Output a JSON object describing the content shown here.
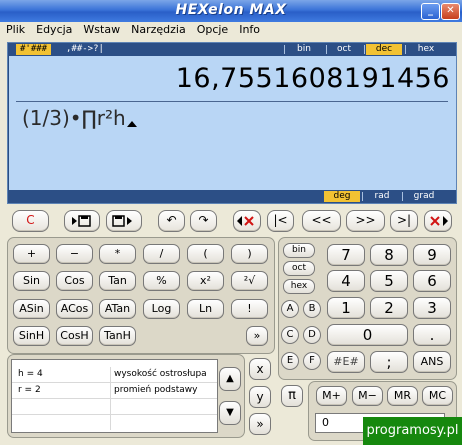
{
  "window": {
    "title": "HEXelon MAX",
    "minimize": "_",
    "close": "✕"
  },
  "menu": [
    "Plik",
    "Edycja",
    "Wstaw",
    "Narzędzia",
    "Opcje",
    "Info"
  ],
  "display": {
    "format_active": "#'###",
    "format_alt": ",##->?|",
    "bases": [
      {
        "label": "bin",
        "active": false
      },
      {
        "label": "oct",
        "active": false
      },
      {
        "label": "dec",
        "active": true
      },
      {
        "label": "hex",
        "active": false
      }
    ],
    "result": "16,7551608191456",
    "expression": "(1/3)•∏r²h",
    "angles": [
      {
        "label": "deg",
        "active": true
      },
      {
        "label": "rad",
        "active": false
      },
      {
        "label": "grad",
        "active": false
      }
    ]
  },
  "toolbar": {
    "clear": "C",
    "save_result": "▶💾",
    "save_out": "💾▶",
    "undo": "↶",
    "redo": "↷",
    "delete_left": "✕",
    "first": "|<",
    "prev": "<<",
    "next": ">>",
    "last": ">|",
    "delete_right": "✕"
  },
  "func_panel": {
    "row1": [
      "+",
      "−",
      "*",
      "/",
      "(",
      ")"
    ],
    "row2": [
      "Sin",
      "Cos",
      "Tan",
      "%",
      "x²",
      "²√"
    ],
    "row3": [
      "ASin",
      "ACos",
      "ATan",
      "Log",
      "Ln",
      "!"
    ],
    "row4": [
      "SinH",
      "CosH",
      "TanH"
    ],
    "more": "»"
  },
  "num_panel": {
    "bases": [
      "bin",
      "oct",
      "hex"
    ],
    "hexletters": [
      "A",
      "B",
      "C",
      "D",
      "E",
      "F"
    ],
    "digits": [
      [
        "7",
        "8",
        "9"
      ],
      [
        "4",
        "5",
        "6"
      ],
      [
        "1",
        "2",
        "3"
      ]
    ],
    "zero": "0",
    "dot": ".",
    "hash": "#E#",
    "semicolon": ";",
    "ans": "ANS"
  },
  "variables": {
    "rows": [
      {
        "name": "h = 4",
        "desc": "wysokość ostrosłupa"
      },
      {
        "name": "r = 2",
        "desc": "promień podstawy"
      }
    ],
    "up": "▲",
    "down": "▼"
  },
  "side_buttons": [
    "x",
    "y",
    "»"
  ],
  "pi": "π",
  "memory": {
    "buttons": [
      "M+",
      "M−",
      "MR",
      "MC"
    ],
    "value": "0"
  },
  "watermark": "programosy.pl"
}
